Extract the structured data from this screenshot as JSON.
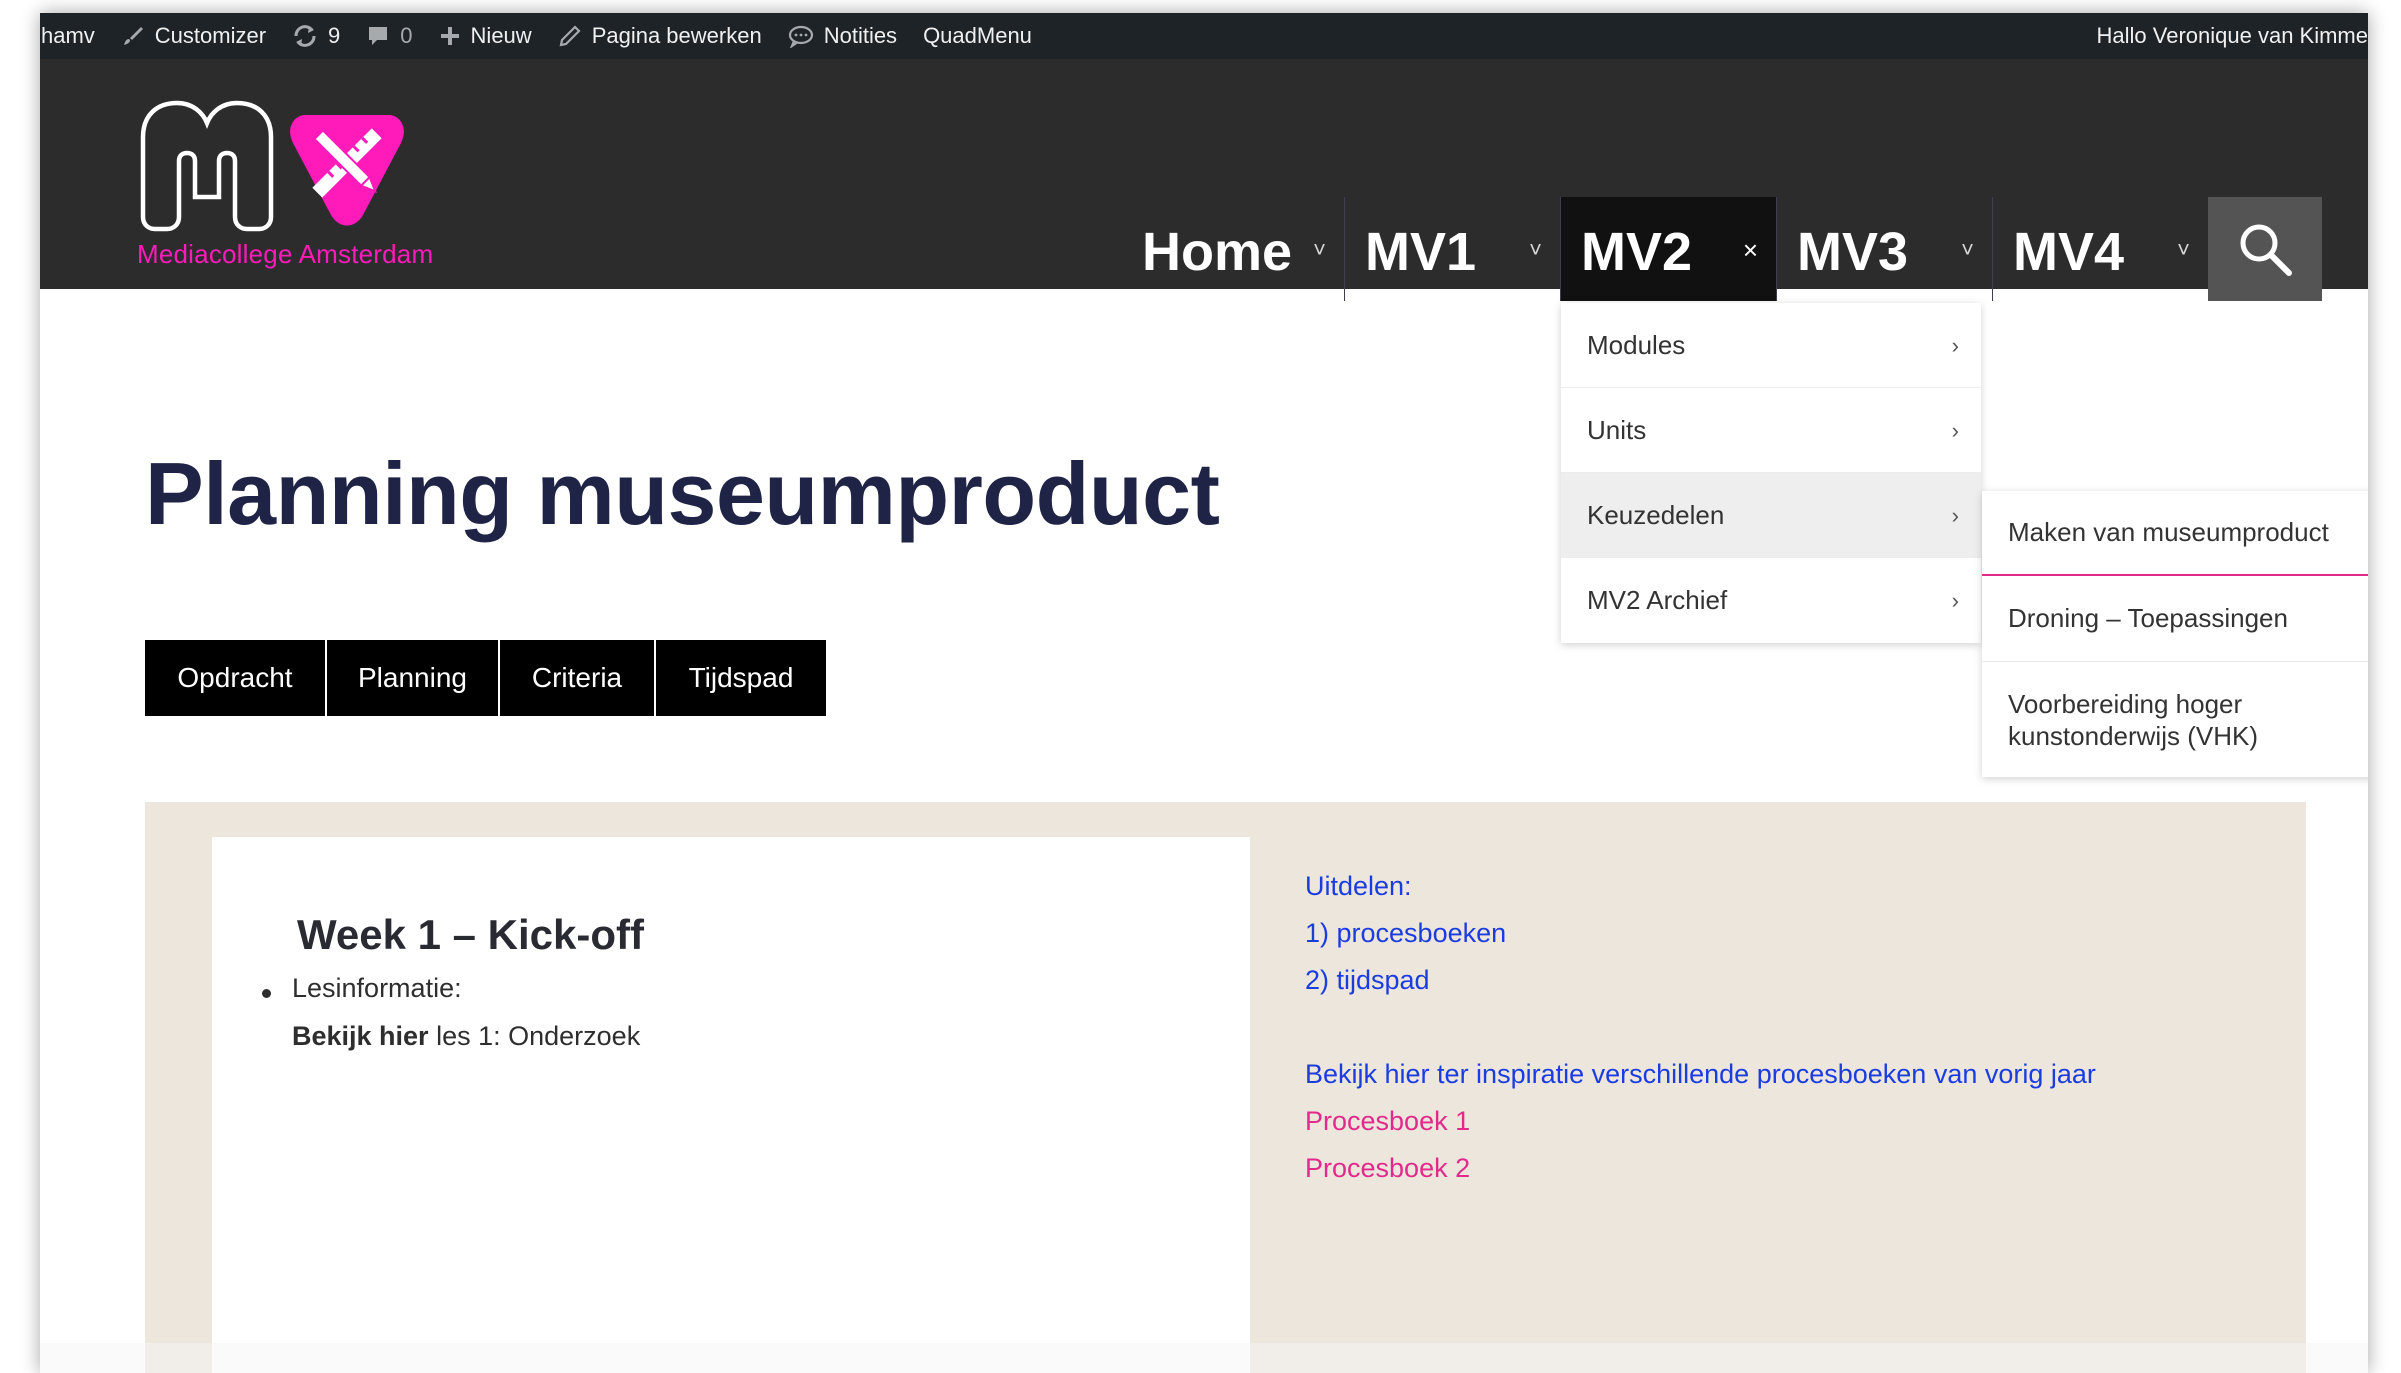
{
  "adminbar": {
    "site": "hamv",
    "customizer": "Customizer",
    "updates_count": "9",
    "comments_count": "0",
    "new": "Nieuw",
    "edit_page": "Pagina bewerken",
    "notes": "Notities",
    "quadmenu": "QuadMenu",
    "greeting": "Hallo Veronique van Kimme"
  },
  "header": {
    "logo_text": "Mediacollege Amsterdam",
    "nav": [
      {
        "label": "Home",
        "caret": "˅"
      },
      {
        "label": "MV1",
        "caret": "˅"
      },
      {
        "label": "MV2",
        "caret": "×"
      },
      {
        "label": "MV3",
        "caret": "˅"
      },
      {
        "label": "MV4",
        "caret": "˅"
      }
    ]
  },
  "dropdown": {
    "items": [
      "Modules",
      "Units",
      "Keuzedelen",
      "MV2 Archief"
    ],
    "chevron": "›",
    "submenu": [
      "Maken van museumproduct",
      "Droning – Toepassingen",
      "Voorbereiding hoger kunstonderwijs (VHK)"
    ]
  },
  "main": {
    "title": "Planning museumproduct",
    "tabs": [
      "Opdracht",
      "Planning",
      "Criteria",
      "Tijdspad"
    ],
    "week_title": "Week 1 – Kick-off",
    "bullet": "Lesinformatie:",
    "lesson_bold": "Bekijk hier",
    "lesson_rest": " les 1: Onderzoek",
    "side": {
      "uitdelen": "Uitdelen:",
      "item1": "1) procesboeken",
      "item2": "2) tijdspad",
      "inspiratie": "Bekijk hier ter inspiratie verschillende procesboeken van vorig jaar",
      "link1": "Procesboek 1",
      "link2": "Procesboek 2"
    }
  },
  "colors": {
    "accent_pink": "#ff1aba",
    "link_blue": "#1b3de0",
    "link_pink": "#e22a8c",
    "title_navy": "#1f2447"
  }
}
